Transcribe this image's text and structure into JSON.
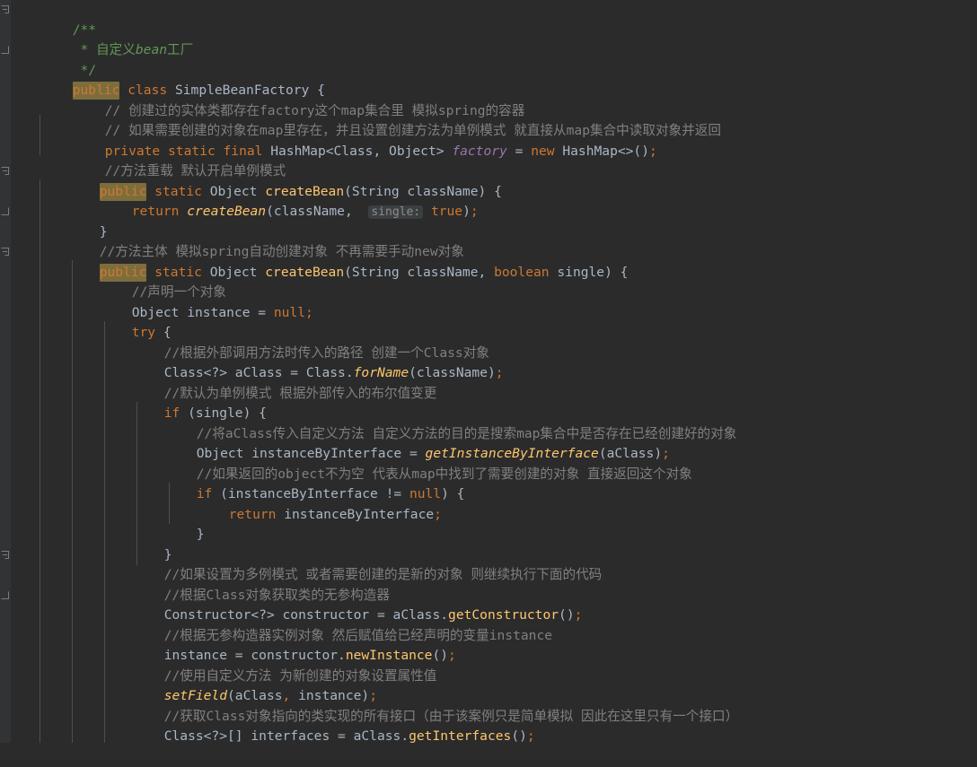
{
  "window": {
    "kind": "code-editor",
    "theme": "darcula",
    "background": "#2b2b2b",
    "gutter_background": "#313335",
    "language": "Java",
    "file": "SimpleBeanFactory"
  },
  "colors": {
    "default_text": "#a9b7c6",
    "keyword": "#cc7832",
    "comment": "#808080",
    "javadoc": "#629755",
    "number": "#6897bb",
    "static_field": "#9876aa",
    "method": "#ffc66d",
    "identifier_highlight": "#7d6d3c",
    "inline_hint_bg": "#3b3f41",
    "inline_hint_fg": "#8c8c8c",
    "indent_guide": "#4b4f52"
  },
  "inline_hints": [
    {
      "label": "single:",
      "line": 9
    }
  ],
  "fold_markers": [
    {
      "type": "fold-start",
      "line": 1
    },
    {
      "type": "fold-end",
      "line": 3
    },
    {
      "type": "fold-start",
      "line": 8
    },
    {
      "type": "fold-end",
      "line": 11
    },
    {
      "type": "fold-start",
      "line": 13
    },
    {
      "type": "fold-start",
      "line": 28
    },
    {
      "type": "fold-end",
      "line": 29
    }
  ],
  "code_lines": [
    {
      "n": 1,
      "indent": 0,
      "text": "/**"
    },
    {
      "n": 2,
      "indent": 0,
      "text": " * 自定义bean工厂"
    },
    {
      "n": 3,
      "indent": 0,
      "text": " */"
    },
    {
      "n": 4,
      "indent": 0,
      "text": "public class SimpleBeanFactory {"
    },
    {
      "n": 5,
      "indent": 1,
      "text": "// 创建过的实体类都存在factory这个map集合里 模拟spring的容器"
    },
    {
      "n": 6,
      "indent": 1,
      "text": "// 如果需要创建的对象在map里存在，并且设置创建方法为单例模式 就直接从map集合中读取对象并返回"
    },
    {
      "n": 7,
      "indent": 1,
      "text": "private static final HashMap<Class, Object> factory = new HashMap<>();"
    },
    {
      "n": 8,
      "indent": 1,
      "text": "//方法重载 默认开启单例模式"
    },
    {
      "n": 9,
      "indent": 1,
      "text": "public static Object createBean(String className) {"
    },
    {
      "n": 10,
      "indent": 2,
      "text": "return createBean(className,  single: true);"
    },
    {
      "n": 11,
      "indent": 1,
      "text": "}"
    },
    {
      "n": 12,
      "indent": 1,
      "text": "//方法主体 模拟spring自动创建对象 不再需要手动new对象"
    },
    {
      "n": 13,
      "indent": 1,
      "text": "public static Object createBean(String className, boolean single) {"
    },
    {
      "n": 14,
      "indent": 2,
      "text": "//声明一个对象"
    },
    {
      "n": 15,
      "indent": 2,
      "text": "Object instance = null;"
    },
    {
      "n": 16,
      "indent": 2,
      "text": "try {"
    },
    {
      "n": 17,
      "indent": 3,
      "text": "//根据外部调用方法时传入的路径 创建一个Class对象"
    },
    {
      "n": 18,
      "indent": 3,
      "text": "Class<?> aClass = Class.forName(className);"
    },
    {
      "n": 19,
      "indent": 3,
      "text": "//默认为单例模式 根据外部传入的布尔值变更"
    },
    {
      "n": 20,
      "indent": 3,
      "text": "if (single) {"
    },
    {
      "n": 21,
      "indent": 4,
      "text": "//将aClass传入自定义方法 自定义方法的目的是搜索map集合中是否存在已经创建好的对象"
    },
    {
      "n": 22,
      "indent": 4,
      "text": "Object instanceByInterface = getInstanceByInterface(aClass);"
    },
    {
      "n": 23,
      "indent": 4,
      "text": "//如果返回的object不为空 代表从map中找到了需要创建的对象 直接返回这个对象"
    },
    {
      "n": 24,
      "indent": 4,
      "text": "if (instanceByInterface != null) {"
    },
    {
      "n": 25,
      "indent": 5,
      "text": "return instanceByInterface;"
    },
    {
      "n": 26,
      "indent": 4,
      "text": "}"
    },
    {
      "n": 27,
      "indent": 3,
      "text": "}"
    },
    {
      "n": 28,
      "indent": 3,
      "text": "//如果设置为多例模式 或者需要创建的是新的对象 则继续执行下面的代码"
    },
    {
      "n": 29,
      "indent": 3,
      "text": "//根据Class对象获取类的无参构造器"
    },
    {
      "n": 30,
      "indent": 3,
      "text": "Constructor<?> constructor = aClass.getConstructor();"
    },
    {
      "n": 31,
      "indent": 3,
      "text": "//根据无参构造器实例对象 然后赋值给已经声明的变量instance"
    },
    {
      "n": 32,
      "indent": 3,
      "text": "instance = constructor.newInstance();"
    },
    {
      "n": 33,
      "indent": 3,
      "text": "//使用自定义方法 为新创建的对象设置属性值"
    },
    {
      "n": 34,
      "indent": 3,
      "text": "setField(aClass, instance);"
    },
    {
      "n": 35,
      "indent": 3,
      "text": "//获取Class对象指向的类实现的所有接口（由于该案例只是简单模拟 因此在这里只有一个接口）"
    },
    {
      "n": 36,
      "indent": 3,
      "text": "Class<?>[] interfaces = aClass.getInterfaces();"
    }
  ]
}
